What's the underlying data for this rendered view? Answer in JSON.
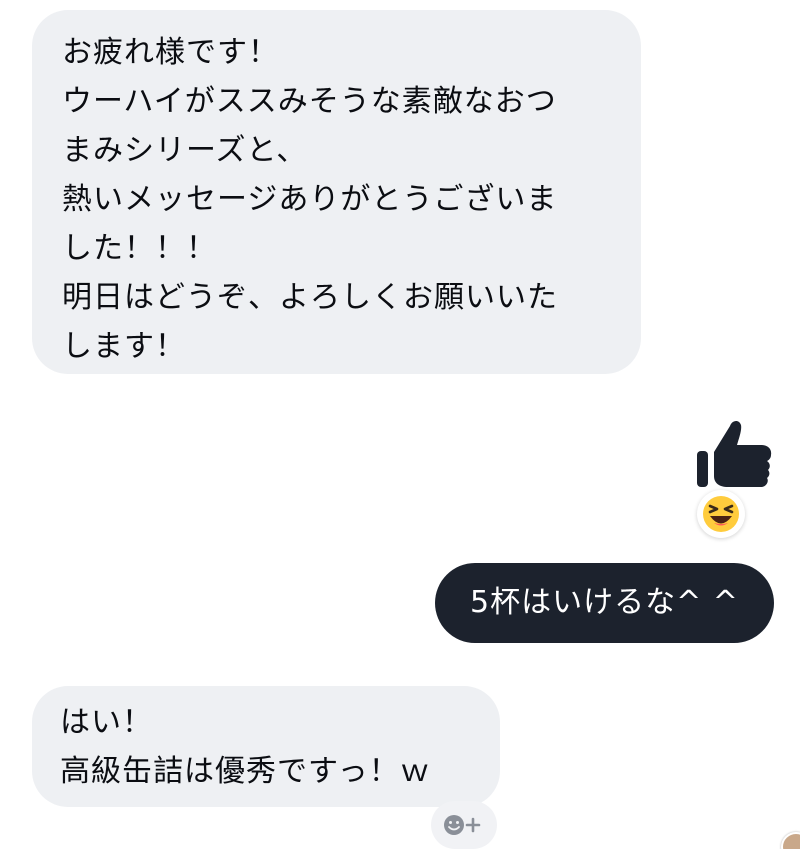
{
  "messages": [
    {
      "sender": "other",
      "lines": [
        "お疲れ様です！",
        "ウーハイがススみそうな素敵なおつ",
        "まみシリーズと、",
        "熱いメッセージありがとうございま",
        "した！！！",
        "明日はどうぞ、よろしくお願いいた",
        "します！"
      ]
    },
    {
      "sender": "me",
      "text": "5杯はいけるな^ ^"
    },
    {
      "sender": "other",
      "lines": [
        "はい！",
        "高級缶詰は優秀ですっ！ｗ"
      ]
    }
  ],
  "reactions": {
    "like_icon": "thumbs-up-icon",
    "reaction_emoji": "laughing-squint-emoji",
    "add_reaction_icon": "smiley-plus-icon"
  },
  "colors": {
    "incoming_bubble": "#eef0f3",
    "outgoing_bubble": "#1c222d",
    "thumb": "#1c222d",
    "emoji_face": "#ffcc3d"
  }
}
